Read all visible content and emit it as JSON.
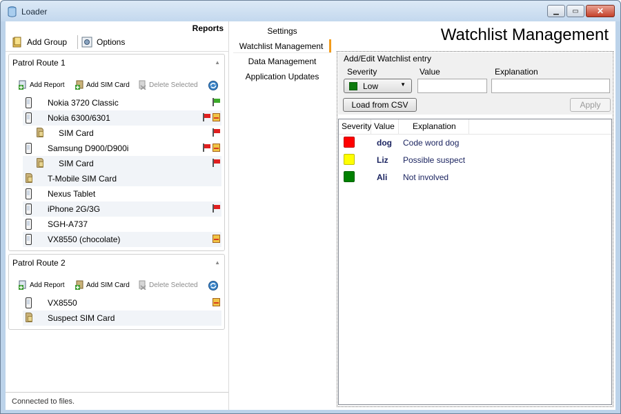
{
  "window": {
    "title": "Loader"
  },
  "toolbar": {
    "reports_header": "Reports",
    "add_group": "Add Group",
    "options": "Options"
  },
  "groups": [
    {
      "title": "Patrol Route 1",
      "actions": {
        "add_report": "Add Report",
        "add_sim": "Add SIM Card",
        "delete_selected": "Delete Selected"
      },
      "devices": [
        {
          "name": "Nokia 3720 Classic",
          "type": "phone",
          "indent": 0,
          "flags": [
            "green-flag"
          ]
        },
        {
          "name": "Nokia 6300/6301",
          "type": "phone",
          "indent": 0,
          "flags": [
            "red-flag",
            "report"
          ]
        },
        {
          "name": "SIM Card",
          "type": "sim",
          "indent": 1,
          "flags": [
            "red-flag"
          ]
        },
        {
          "name": "Samsung D900/D900i",
          "type": "phone",
          "indent": 0,
          "flags": [
            "red-flag",
            "report"
          ]
        },
        {
          "name": "SIM Card",
          "type": "sim",
          "indent": 1,
          "flags": [
            "red-flag"
          ]
        },
        {
          "name": "T-Mobile SIM Card",
          "type": "sim",
          "indent": 0,
          "flags": []
        },
        {
          "name": "Nexus Tablet",
          "type": "phone",
          "indent": 0,
          "flags": []
        },
        {
          "name": "iPhone 2G/3G",
          "type": "phone",
          "indent": 0,
          "flags": [
            "red-flag"
          ]
        },
        {
          "name": "SGH-A737",
          "type": "phone",
          "indent": 0,
          "flags": []
        },
        {
          "name": "VX8550 (chocolate)",
          "type": "phone",
          "indent": 0,
          "flags": [
            "report"
          ]
        }
      ]
    },
    {
      "title": "Patrol Route 2",
      "actions": {
        "add_report": "Add Report",
        "add_sim": "Add SIM Card",
        "delete_selected": "Delete Selected"
      },
      "devices": [
        {
          "name": "VX8550",
          "type": "phone",
          "indent": 0,
          "flags": [
            "report"
          ]
        },
        {
          "name": "Suspect SIM Card",
          "type": "sim",
          "indent": 0,
          "flags": []
        }
      ]
    }
  ],
  "status": "Connected to files.",
  "nav": {
    "items": [
      "Settings",
      "Watchlist Management",
      "Data Management",
      "Application Updates"
    ],
    "selected": "Watchlist Management"
  },
  "page": {
    "title": "Watchlist Management"
  },
  "editor": {
    "legend": "Add/Edit Watchlist entry",
    "severity_label": "Severity",
    "value_label": "Value",
    "explanation_label": "Explanation",
    "severity_selected": "Low",
    "severity_selected_color": "#0d7a0d",
    "value_input": "",
    "explanation_input": "",
    "load_csv": "Load from CSV",
    "apply": "Apply"
  },
  "watchlist": {
    "columns": [
      "Severity",
      "Value",
      "Explanation"
    ],
    "rows": [
      {
        "color": "#ff0000",
        "value": "dog",
        "explanation": "Code word dog"
      },
      {
        "color": "#ffff00",
        "value": "Liz",
        "explanation": "Possible suspect"
      },
      {
        "color": "#008000",
        "value": "Ali",
        "explanation": "Not involved"
      }
    ]
  }
}
